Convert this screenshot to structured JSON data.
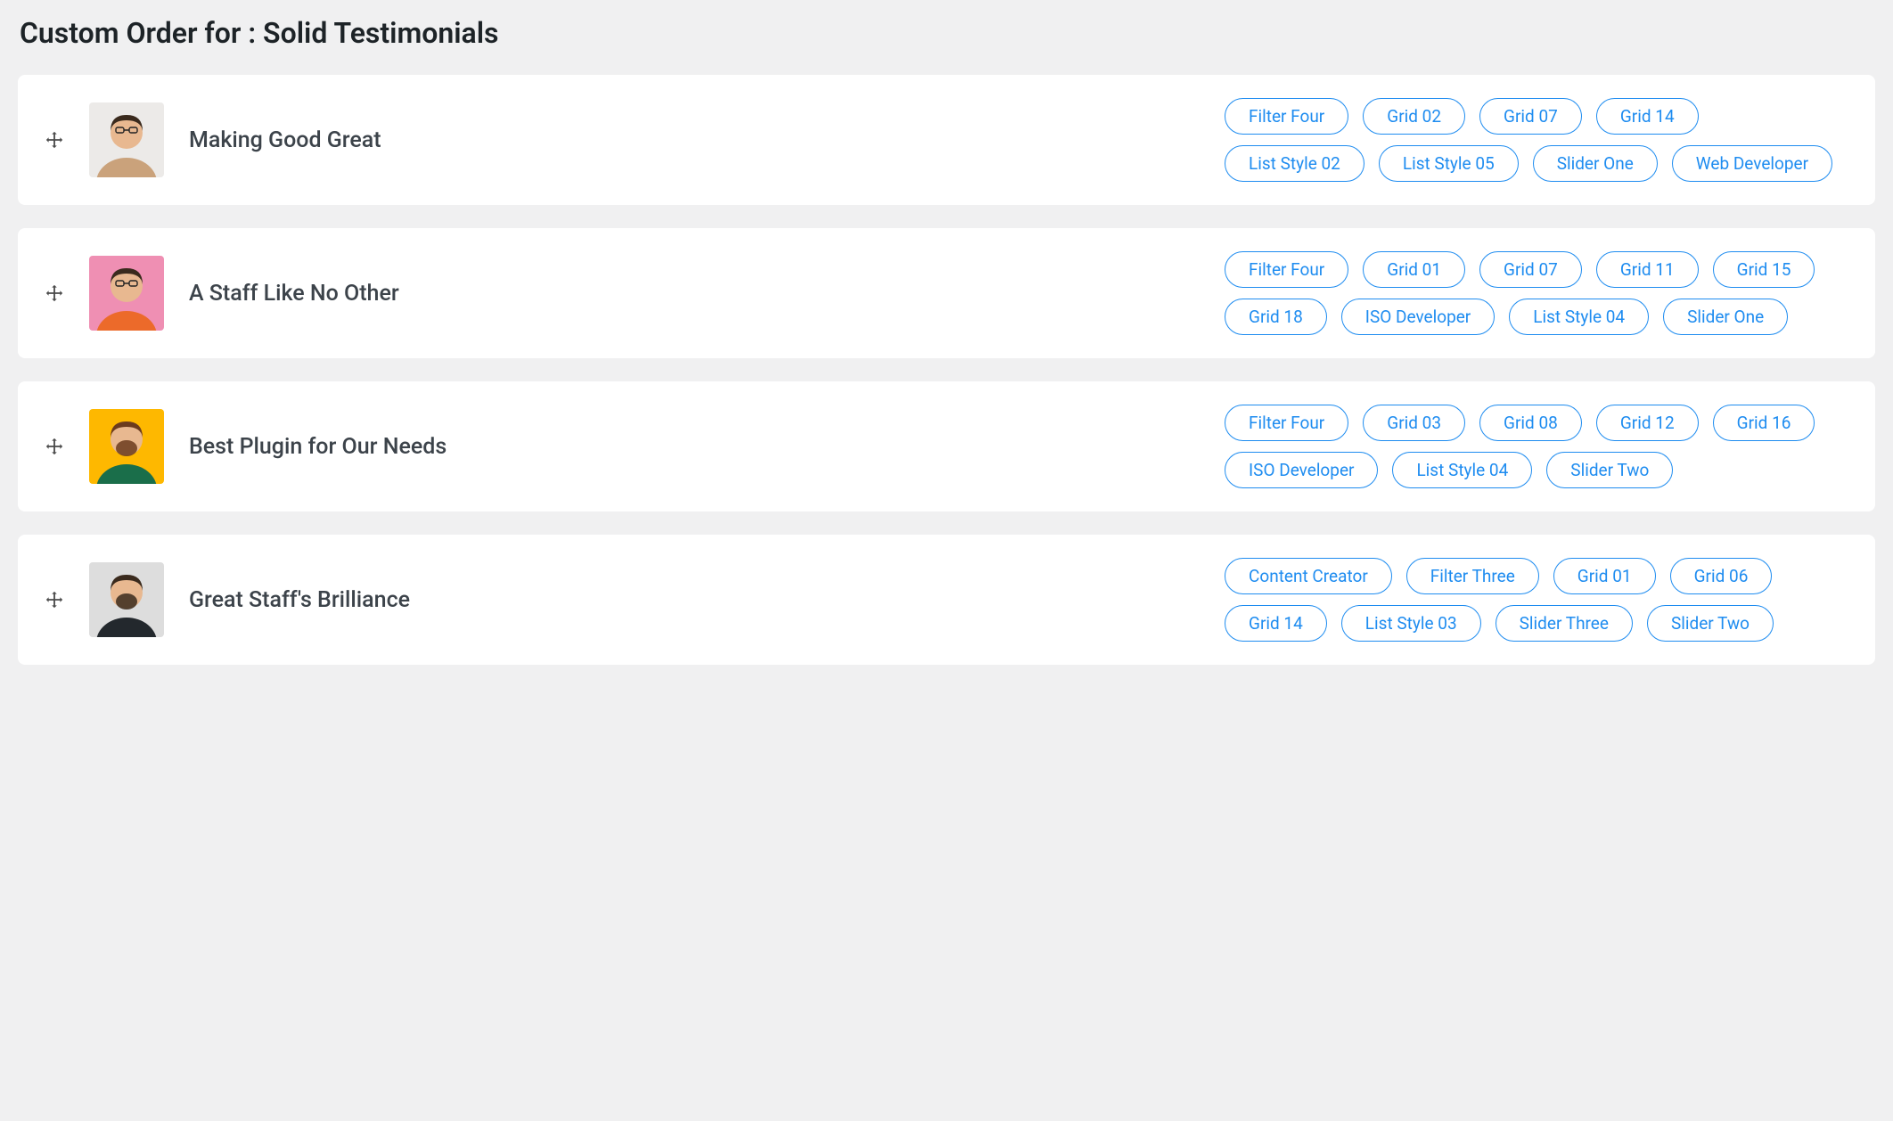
{
  "page": {
    "title": "Custom Order for : Solid Testimonials"
  },
  "items": [
    {
      "title": "Making Good Great",
      "avatar_bg": "#eceae8",
      "avatar_variant": 0,
      "tags": [
        "Filter Four",
        "Grid 02",
        "Grid 07",
        "Grid 14",
        "List Style 02",
        "List Style 05",
        "Slider One",
        "Web Developer"
      ]
    },
    {
      "title": "A Staff Like No Other",
      "avatar_bg": "#ef8fb3",
      "avatar_variant": 1,
      "tags": [
        "Filter Four",
        "Grid 01",
        "Grid 07",
        "Grid 11",
        "Grid 15",
        "Grid 18",
        "ISO Developer",
        "List Style 04",
        "Slider One"
      ]
    },
    {
      "title": "Best Plugin for Our Needs",
      "avatar_bg": "#feb800",
      "avatar_variant": 2,
      "tags": [
        "Filter Four",
        "Grid 03",
        "Grid 08",
        "Grid 12",
        "Grid 16",
        "ISO Developer",
        "List Style 04",
        "Slider Two"
      ]
    },
    {
      "title": "Great Staff's Brilliance",
      "avatar_bg": "#dddddd",
      "avatar_variant": 3,
      "tags": [
        "Content Creator",
        "Filter Three",
        "Grid 01",
        "Grid 06",
        "Grid 14",
        "List Style 03",
        "Slider Three",
        "Slider Two"
      ]
    }
  ]
}
